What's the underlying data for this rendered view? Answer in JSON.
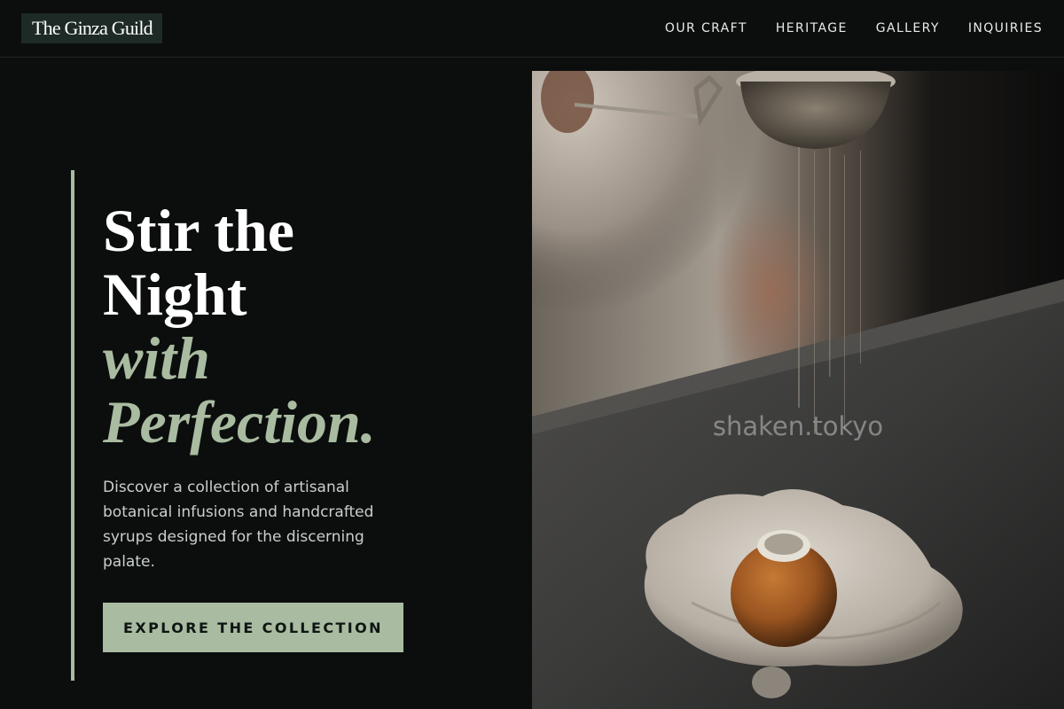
{
  "brand": {
    "name": "The Ginza Guild"
  },
  "nav": {
    "items": [
      {
        "label": "OUR CRAFT"
      },
      {
        "label": "HERITAGE"
      },
      {
        "label": "GALLERY"
      },
      {
        "label": "INQUIRIES"
      }
    ]
  },
  "hero": {
    "headline_line1": "Stir the",
    "headline_line2": "Night",
    "headline_italic_line1": "with",
    "headline_italic_line2": "Perfection.",
    "description": "Discover a collection of artisanal botanical infusions and handcrafted syrups designed for the discerning palate.",
    "cta_label": "EXPLORE THE COLLECTION",
    "image_watermark": "shaken.tokyo"
  },
  "colors": {
    "background": "#0b0e0d",
    "accent": "#a9bba0",
    "logo_bg": "#1d2a25"
  }
}
